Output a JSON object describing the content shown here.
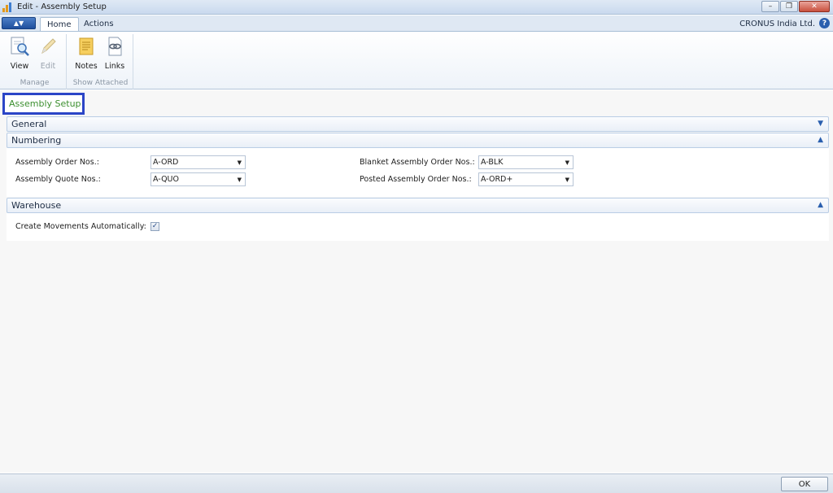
{
  "window": {
    "title": "Edit - Assembly Setup"
  },
  "ribbon": {
    "tabs": [
      {
        "label": "Home"
      },
      {
        "label": "Actions"
      }
    ],
    "company": "CRONUS India Ltd.",
    "groups": [
      {
        "label": "Manage",
        "buttons": [
          {
            "label": "View",
            "icon": "view-icon"
          },
          {
            "label": "Edit",
            "icon": "edit-icon"
          }
        ]
      },
      {
        "label": "Show Attached",
        "buttons": [
          {
            "label": "Notes",
            "icon": "notes-icon"
          },
          {
            "label": "Links",
            "icon": "links-icon"
          }
        ]
      }
    ]
  },
  "page": {
    "title": "Assembly Setup"
  },
  "fasttabs": {
    "general": {
      "label": "General"
    },
    "numbering": {
      "label": "Numbering",
      "assembly_order_nos": {
        "label": "Assembly Order Nos.:",
        "value": "A-ORD"
      },
      "assembly_quote_nos": {
        "label": "Assembly Quote Nos.:",
        "value": "A-QUO"
      },
      "blanket_assembly_order_nos": {
        "label": "Blanket Assembly Order Nos.:",
        "value": "A-BLK"
      },
      "posted_assembly_order_nos": {
        "label": "Posted Assembly Order Nos.:",
        "value": "A-ORD+"
      }
    },
    "warehouse": {
      "label": "Warehouse",
      "create_movements": {
        "label": "Create Movements Automatically:",
        "checked": true
      }
    }
  },
  "footer": {
    "ok_label": "OK"
  },
  "colors": {
    "title_highlight": "#2b45c7",
    "page_title": "#3c8f2f",
    "accent": "#2a5fae"
  }
}
